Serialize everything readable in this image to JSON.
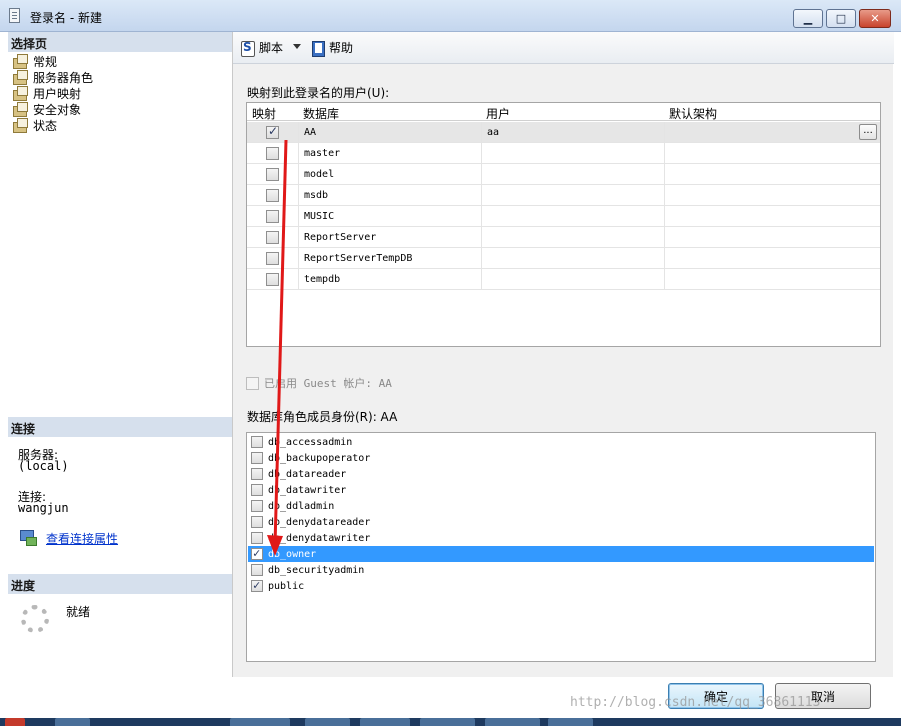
{
  "window": {
    "title": "登录名 - 新建"
  },
  "left": {
    "select_page_header": "选择页",
    "nav": [
      "常规",
      "服务器角色",
      "用户映射",
      "安全对象",
      "状态"
    ],
    "connection_header": "连接",
    "server_label": "服务器:",
    "server_value": "(local)",
    "connection_label": "连接:",
    "connection_value": "wangjun",
    "view_props_link": "查看连接属性",
    "progress_header": "进度",
    "progress_status": "就绪"
  },
  "toolbar": {
    "script_label": "脚本",
    "help_label": "帮助"
  },
  "mapping": {
    "label": "映射到此登录名的用户(U):",
    "columns": [
      "映射",
      "数据库",
      "用户",
      "默认架构"
    ],
    "rows": [
      {
        "map": true,
        "db": "AA",
        "user": "aa",
        "schema": ""
      },
      {
        "map": false,
        "db": "master",
        "user": "",
        "schema": ""
      },
      {
        "map": false,
        "db": "model",
        "user": "",
        "schema": ""
      },
      {
        "map": false,
        "db": "msdb",
        "user": "",
        "schema": ""
      },
      {
        "map": false,
        "db": "MUSIC",
        "user": "",
        "schema": ""
      },
      {
        "map": false,
        "db": "ReportServer",
        "user": "",
        "schema": ""
      },
      {
        "map": false,
        "db": "ReportServerTempDB",
        "user": "",
        "schema": ""
      },
      {
        "map": false,
        "db": "tempdb",
        "user": "",
        "schema": ""
      }
    ],
    "browse_button": "..."
  },
  "guest": {
    "label": "已启用 Guest 帐户: AA"
  },
  "roles": {
    "label": "数据库角色成员身份(R): AA",
    "items": [
      {
        "name": "db_accessadmin",
        "checked": false,
        "selected": false
      },
      {
        "name": "db_backupoperator",
        "checked": false,
        "selected": false
      },
      {
        "name": "db_datareader",
        "checked": false,
        "selected": false
      },
      {
        "name": "db_datawriter",
        "checked": false,
        "selected": false
      },
      {
        "name": "db_ddladmin",
        "checked": false,
        "selected": false
      },
      {
        "name": "db_denydatareader",
        "checked": false,
        "selected": false
      },
      {
        "name": "db_denydatawriter",
        "checked": false,
        "selected": false
      },
      {
        "name": "db_owner",
        "checked": true,
        "selected": true
      },
      {
        "name": "db_securityadmin",
        "checked": false,
        "selected": false
      },
      {
        "name": "public",
        "checked": true,
        "selected": false
      }
    ]
  },
  "buttons": {
    "ok": "确定",
    "cancel": "取消"
  },
  "watermark": "http://blog.csdn.net/qq_36861113"
}
